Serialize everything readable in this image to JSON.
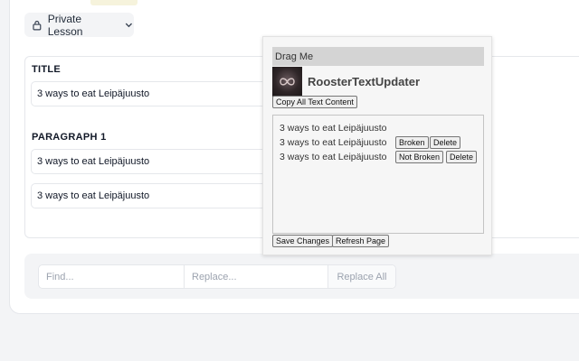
{
  "lesson": {
    "label": "Private Lesson"
  },
  "sections": {
    "title": {
      "label": "TITLE",
      "value": "3 ways to eat Leipäjuusto"
    },
    "paragraph": {
      "label": "PARAGRAPH 1",
      "values": [
        "3 ways to eat Leipäjuusto",
        "3 ways to eat Leipäjuusto"
      ]
    }
  },
  "find_replace": {
    "find_placeholder": "Find...",
    "replace_placeholder": "Replace...",
    "replace_all_label": "Replace All"
  },
  "popup": {
    "drag_label": "Drag Me",
    "app_name": "RoosterTextUpdater",
    "copy_label": "Copy All Text Content",
    "lines": [
      {
        "text": "3 ways to eat Leipäjuusto"
      },
      {
        "text": "3 ways to eat Leipäjuusto",
        "status": "Broken",
        "delete": "Delete"
      },
      {
        "text": "3 ways to eat Leipäjuusto",
        "status": "Not Broken",
        "delete": "Delete"
      }
    ],
    "save_label": "Save Changes",
    "refresh_label": "Refresh Page"
  },
  "icons": {
    "lesson_icon": "lock-icon",
    "dropdown_icon": "chevron-down-icon",
    "logo": "app-logo"
  }
}
